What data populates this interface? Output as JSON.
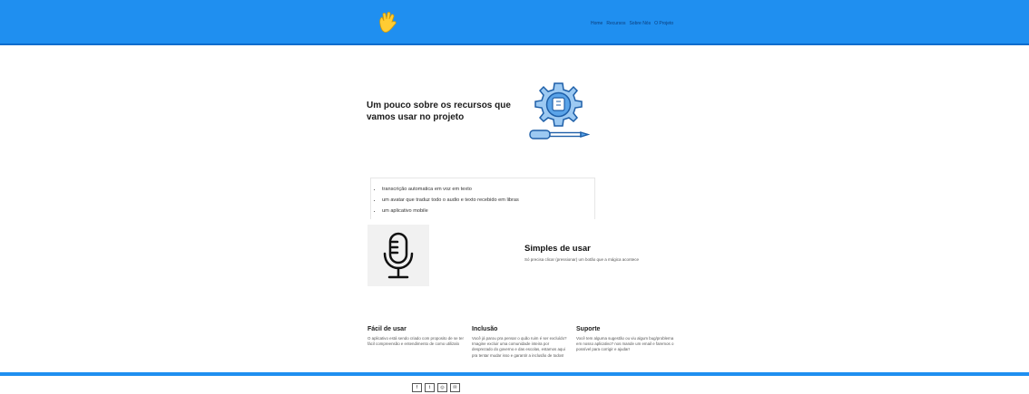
{
  "navbar": {
    "links": [
      "Home",
      "Recursos",
      "Sobre Nós",
      "O Projeto"
    ],
    "color": "#1f8ff0"
  },
  "hero": {
    "title": "Um pouco sobre os recursos que vamos usar no projeto",
    "illustration": "gear-screwdriver-icon"
  },
  "features": {
    "items": [
      "transcrição automatica em voz em texto",
      "um avatar que traduz todo o audio e texto recebido em libras",
      "um aplicativo mobile"
    ]
  },
  "simple": {
    "title": "Simples de usar",
    "text": "Só precisa clicar (pressionar) um botão que a mágica acontece",
    "illustration": "microphone-icon"
  },
  "columns": [
    {
      "title": "Fácil de usar",
      "text": "O aplicativo está sendo criado com proposito de se ter fácil compreensão e entendimento de como utilizalo"
    },
    {
      "title": "Inclusão",
      "text": "Você já parou pra pensar o quão ruim é ser excluído? Imagine excluir uma comunidade inteira por desprezado do governo e das escolas, estamos aqui pra tentar mudar isso e garantir a inclusão de todos!"
    },
    {
      "title": "Suporte",
      "text": "Você tem alguma sugestão ou viu algum bug/problema em nosso aplicativo? nos mande um email e faremos o possível para corrigir e ajudar!"
    }
  ],
  "footer": {
    "social": [
      {
        "icon": "facebook-icon",
        "glyph": "f"
      },
      {
        "icon": "twitter-icon",
        "glyph": "t"
      },
      {
        "icon": "instagram-icon",
        "glyph": "◎"
      },
      {
        "icon": "email-icon",
        "glyph": "✉"
      }
    ]
  }
}
